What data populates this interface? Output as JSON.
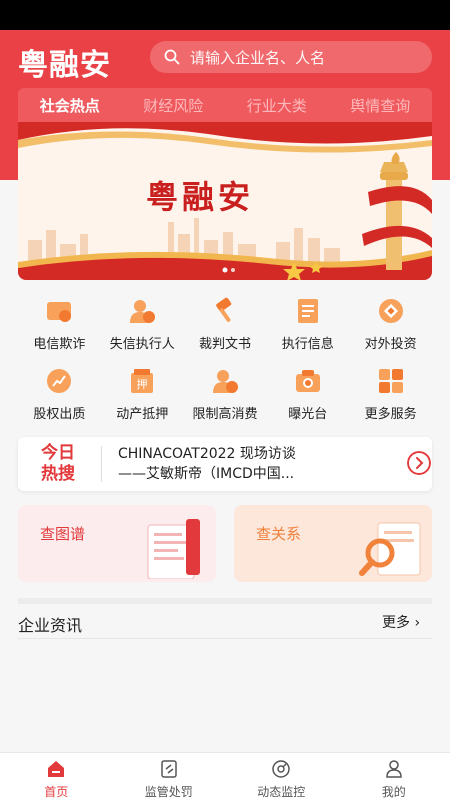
{
  "app": {
    "logo": "粤融安"
  },
  "search": {
    "placeholder": "请输入企业名、人名"
  },
  "tabs": [
    {
      "label": "社会热点",
      "active": true
    },
    {
      "label": "财经风险",
      "active": false
    },
    {
      "label": "行业大类",
      "active": false
    },
    {
      "label": "舆情查询",
      "active": false
    }
  ],
  "banner": {
    "title": "粤融安"
  },
  "services": [
    {
      "label": "电信欺诈",
      "icon": "phone-fraud-icon"
    },
    {
      "label": "失信执行人",
      "icon": "dishonest-person-icon"
    },
    {
      "label": "裁判文书",
      "icon": "gavel-icon"
    },
    {
      "label": "执行信息",
      "icon": "document-icon"
    },
    {
      "label": "对外投资",
      "icon": "investment-icon"
    },
    {
      "label": "股权出质",
      "icon": "chart-icon"
    },
    {
      "label": "动产抵押",
      "icon": "mortgage-icon"
    },
    {
      "label": "限制高消费",
      "icon": "consumption-limit-icon"
    },
    {
      "label": "曝光台",
      "icon": "camera-icon"
    },
    {
      "label": "更多服务",
      "icon": "more-grid-icon"
    }
  ],
  "hot_search": {
    "tag_line1": "今日",
    "tag_line2": "热搜",
    "line1": "CHINACOAT2022 现场访谈",
    "line2": "——艾敏斯帝（IMCD中国..."
  },
  "cards": {
    "graph": "查图谱",
    "relation": "查关系"
  },
  "news": {
    "title": "企业资讯",
    "more": "更多"
  },
  "bottom_nav": [
    {
      "label": "首页",
      "icon": "home-icon",
      "active": true
    },
    {
      "label": "监管处罚",
      "icon": "penalty-icon",
      "active": false
    },
    {
      "label": "动态监控",
      "icon": "monitor-icon",
      "active": false
    },
    {
      "label": "我的",
      "icon": "profile-icon",
      "active": false
    }
  ],
  "colors": {
    "brand_red": "#e94145",
    "accent_orange": "#f0823c"
  }
}
